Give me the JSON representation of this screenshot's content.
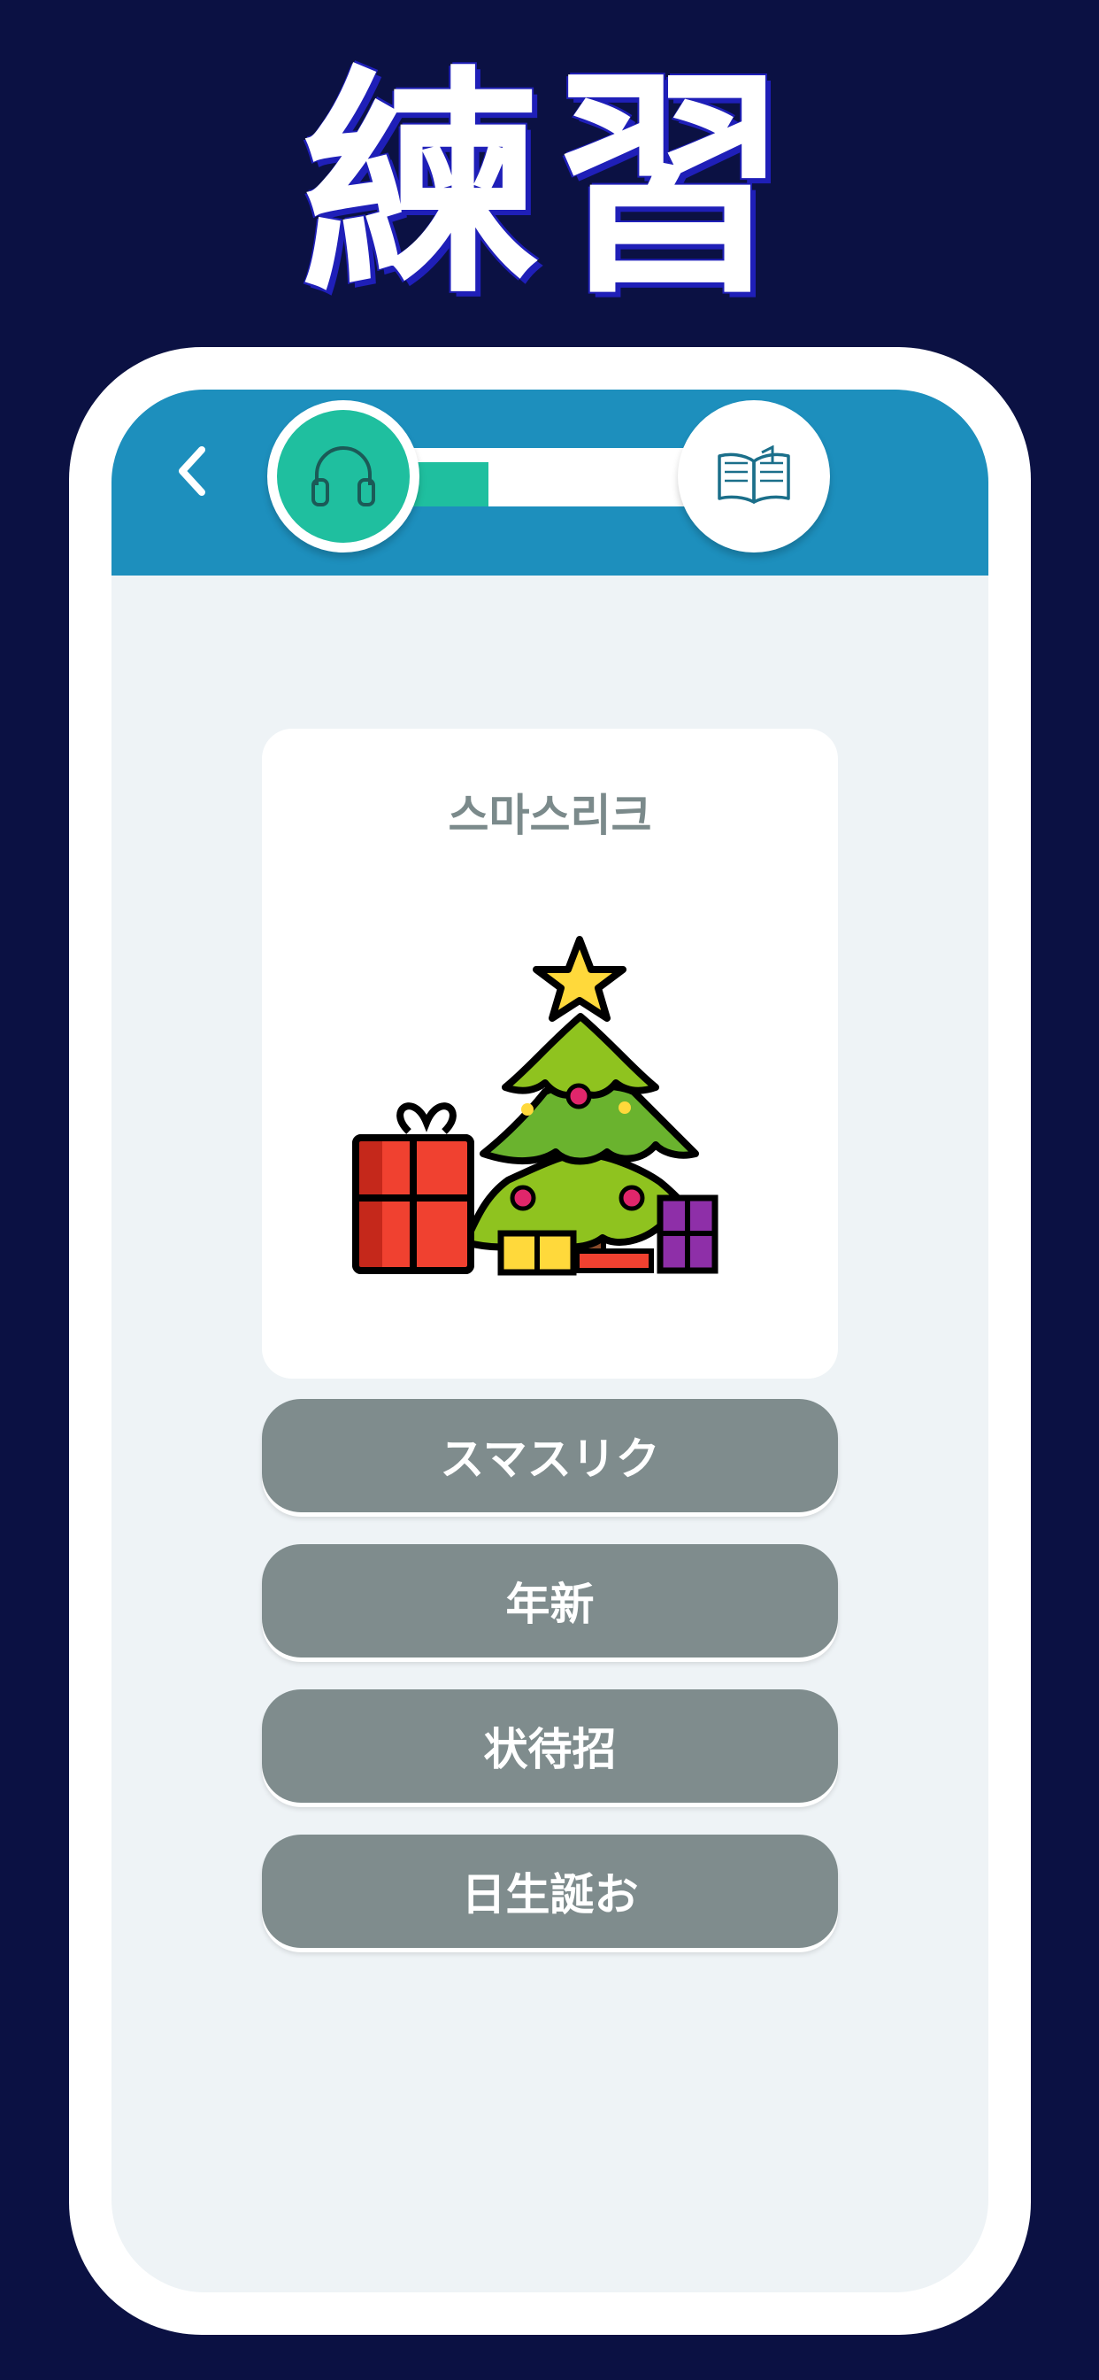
{
  "headline": "練習",
  "colors": {
    "background": "#0b1143",
    "header": "#1d8fbd",
    "accent": "#1fbf9f",
    "answer_button": "#7f8c8d",
    "screen": "#eef3f6"
  },
  "header": {
    "back_icon": "chevron-left-icon",
    "progress": 0.4,
    "steps": [
      {
        "icon": "headphones-icon",
        "state": "active"
      },
      {
        "icon": "open-book-icon",
        "state": "inactive"
      }
    ]
  },
  "card": {
    "word": "스마스리크",
    "image": "christmas-tree-with-gifts"
  },
  "answers": [
    "スマスリク",
    "年新",
    "状待招",
    "日生誕お"
  ]
}
